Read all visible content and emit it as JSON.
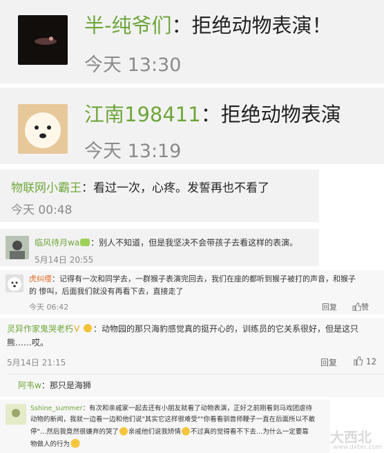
{
  "comments": [
    {
      "name": "半-纯爷们",
      "text": "：拒绝动物表演！",
      "time": "今天 13:30"
    },
    {
      "name": "江南198411",
      "text": "：拒绝动物表演",
      "time": "今天 13:19"
    },
    {
      "name": "物联网小霸王",
      "text": "：看过一次，心疼。发誓再也不看了",
      "time": "今天 00:48"
    },
    {
      "name": "临风待月wa",
      "text": "：别人不知道，但是我坚决不会带孩子去看这样的表演。",
      "time": "5月14日 20:55"
    },
    {
      "name": "虎纠缨",
      "text": "：记得有一次和同学去，一群猴子表演完回去，我们在座的都听到猴子被打的声音，和猴子",
      "text2": "的 惨叫，后面我们就没有再看下去，直接走了",
      "time": "今天 06:42",
      "reply": "回复",
      "like": "赞"
    },
    {
      "name": "灵异作家鬼哭老朽",
      "text": "：动物园的那只海豹感觉真的挺开心的，训练员的它关系很好，但是这只",
      "text2": "熊……哎。",
      "time": "5月14日 21:15",
      "reply": "回复",
      "like_count": "12"
    },
    {
      "name": "阿韦w",
      "text": "：那只是海狮"
    },
    {
      "name": "Sshine_summer",
      "line1": "：有次和亲戚家一起去还有小朋友就看了动物表演，正好之前刚看到马戏团虐待",
      "line2": "动物的新闻，我就一边看一边和他们说\"其实它这样很难受\"\"你看看驯兽师鞭子一直在后面所以不敢",
      "line3a": "停\"…然后我竟然很嫌弃的哭了",
      "line3b": "亲戚他们说我矫情",
      "line3c": "不过真的觉得看不下去…为什么一定要靠",
      "line4": "物做人的行为"
    }
  ],
  "watermark": {
    "text": "大西北",
    "url": "www.dxbei.com"
  }
}
